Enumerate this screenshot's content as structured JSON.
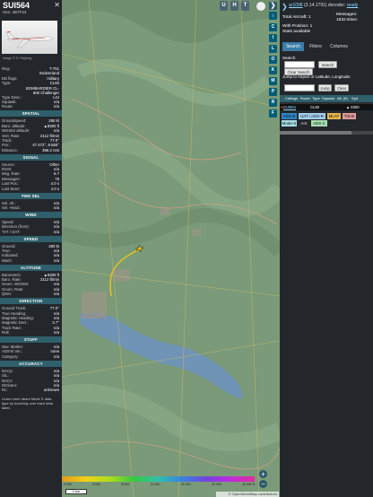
{
  "sidebar": {
    "callsign": "SUI564",
    "hex": "Hex: 4B7F44",
    "close": "✕",
    "photo_credit": "Image © G. Rajberg",
    "reg": {
      "k": "Reg.:",
      "v": "T-751"
    },
    "country": {
      "k": "",
      "v": "Switzerland"
    },
    "dbflags": {
      "k": "DB flags:",
      "v": "military"
    },
    "type": {
      "k": "Type:",
      "v": "CL60"
    },
    "typename": {
      "k": "",
      "v": "BOMBARDIER CL-600 Challenger"
    },
    "typedesc": {
      "k": "Type Desc.:",
      "v": "L2J"
    },
    "squawk": {
      "k": "Squawk:",
      "v": "n/a"
    },
    "route": {
      "k": "Route:",
      "v": "n/a"
    },
    "sections": {
      "spatial": "SPATIAL",
      "signal": "SIGNAL",
      "fmssel": "FMS SEL",
      "wind": "WIND",
      "speed": "SPEED",
      "altitude": "ALTITUDE",
      "direction": "DIRECTION",
      "stuff": "STUFF",
      "accuracy": "ACCURACY"
    },
    "spatial": [
      {
        "k": "Groundspeed:",
        "v": "280 kt"
      },
      {
        "k": "Baro. altitude:",
        "v": "▲8300 ft"
      },
      {
        "k": "WGS84 altitude:",
        "v": "n/a"
      },
      {
        "k": "Vert. Rate:",
        "v": "2112 ft/min"
      },
      {
        "k": "Track:",
        "v": "77.0°"
      },
      {
        "k": "Pos.:",
        "v": "47.472°, 8.655°"
      },
      {
        "k": "Distance:",
        "v": "358.2 nmi"
      }
    ],
    "signal": [
      {
        "k": "Source:",
        "v": "Other"
      },
      {
        "k": "RSSI:",
        "v": "n/a"
      },
      {
        "k": "Msg. Rate:",
        "v": "6.7"
      },
      {
        "k": "Messages:",
        "v": "78"
      },
      {
        "k": "Last Pos.:",
        "v": "4.0 s"
      },
      {
        "k": "Last Seen:",
        "v": "4.0 s"
      }
    ],
    "fmssel": [
      {
        "k": "Sel. Alt.:",
        "v": "n/a"
      },
      {
        "k": "Sel. Head.:",
        "v": "n/a"
      }
    ],
    "wind": [
      {
        "k": "Speed:",
        "v": "n/a"
      },
      {
        "k": "Direction (from):",
        "v": "n/a"
      },
      {
        "k": "TAT / OAT:",
        "v": "n/a"
      }
    ],
    "speed": [
      {
        "k": "Ground:",
        "v": "280 kt"
      },
      {
        "k": "True:",
        "v": "n/a"
      },
      {
        "k": "Indicated:",
        "v": "n/a"
      },
      {
        "k": "Mach:",
        "v": "n/a"
      }
    ],
    "altitude": [
      {
        "k": "Barometric:",
        "v": "▲8300 ft"
      },
      {
        "k": "Baro. Rate:",
        "v": "2112 ft/min"
      },
      {
        "k": "Geom. WGS84:",
        "v": "n/a"
      },
      {
        "k": "Geom. Rate:",
        "v": "n/a"
      },
      {
        "k": "QNH:",
        "v": "n/a"
      }
    ],
    "direction": [
      {
        "k": "Ground Track:",
        "v": "77.0°"
      },
      {
        "k": "True Heading:",
        "v": "n/a"
      },
      {
        "k": "Magnetic Heading:",
        "v": "n/a"
      },
      {
        "k": "Magnetic Decl.:",
        "v": "3.7°"
      },
      {
        "k": "Track Rate:",
        "v": "n/a"
      },
      {
        "k": "Roll:",
        "v": "n/a"
      }
    ],
    "stuff": [
      {
        "k": "Nav. Modes:",
        "v": "n/a"
      },
      {
        "k": "ADS-B Ver.:",
        "v": "none"
      },
      {
        "k": "Category:",
        "v": "n/a"
      }
    ],
    "accuracy": [
      {
        "k": "NACp:",
        "v": "n/a"
      },
      {
        "k": "SIL:",
        "v": "n/a"
      },
      {
        "k": "NACv:",
        "v": "n/a"
      },
      {
        "k": "NICbaro:",
        "v": "n/a"
      },
      {
        "k": "Rc:",
        "v": "unknown"
      }
    ],
    "help": "Learn more about Mode S data type by hovering over each data label."
  },
  "map": {
    "buttons": [
      "U",
      "H",
      "T"
    ],
    "side_buttons": [
      "C",
      "I",
      "L",
      "O",
      "K",
      "M",
      "P",
      "R"
    ],
    "tab": "❯",
    "colorbar_labels": [
      "4 000",
      "6 000",
      "8 000",
      "10 000",
      "20 000",
      "30 000",
      "40 000 ft"
    ],
    "scale": "2 km",
    "attribution": "© OpenStreetMap contributors.",
    "zoom_in": "+",
    "zoom_out": "−"
  },
  "panel": {
    "chevron": "❯",
    "version_link": "ar1098",
    "version_rest": " (3.14.1791) decoder: ",
    "version_status": "ready",
    "total_aircraft": "Total Aircraft: 1",
    "messages": "Messages:",
    "messages_rate": "1632.5/sec",
    "with_position": "With Position: 1",
    "stats": "Stats available",
    "tabs": [
      "Search",
      "Filters",
      "Columns"
    ],
    "search_label": "Search:",
    "search_btn": "Search",
    "clear_search_btn": "Clear Search",
    "jump_label": "Jump to Airport or Latitude, Longitude:",
    "jump_btn": "Jump",
    "clear_btn": "Clear",
    "table_headers": [
      "Callsign",
      "Route",
      "Type",
      "Squawk",
      "Alt. (ft)",
      "Spd"
    ],
    "row": {
      "callsign": "SUI564",
      "type": "CL60",
      "alt": "▲ 8300"
    },
    "tags": [
      {
        "label": "ADS-B",
        "color": "#2f84c4"
      },
      {
        "label": "UAT / ADS-R",
        "color": "#a3d0ee"
      },
      {
        "label": "MLAT",
        "color": "#e7b64d"
      },
      {
        "label": "TIS-B",
        "color": "#e29a9a"
      },
      {
        "label": "Mode-S",
        "color": "#a6dce8"
      },
      {
        "label": "AIS",
        "color": "#23272c"
      },
      {
        "label": "ADS-C",
        "color": "#a7e0b1"
      }
    ]
  },
  "colors": {
    "sidebar_bg": "#23272c",
    "section_bg": "#2f5f6a",
    "accent": "#3a7ca5",
    "aircraft": "#f2d017",
    "track": "#e0c02a"
  }
}
